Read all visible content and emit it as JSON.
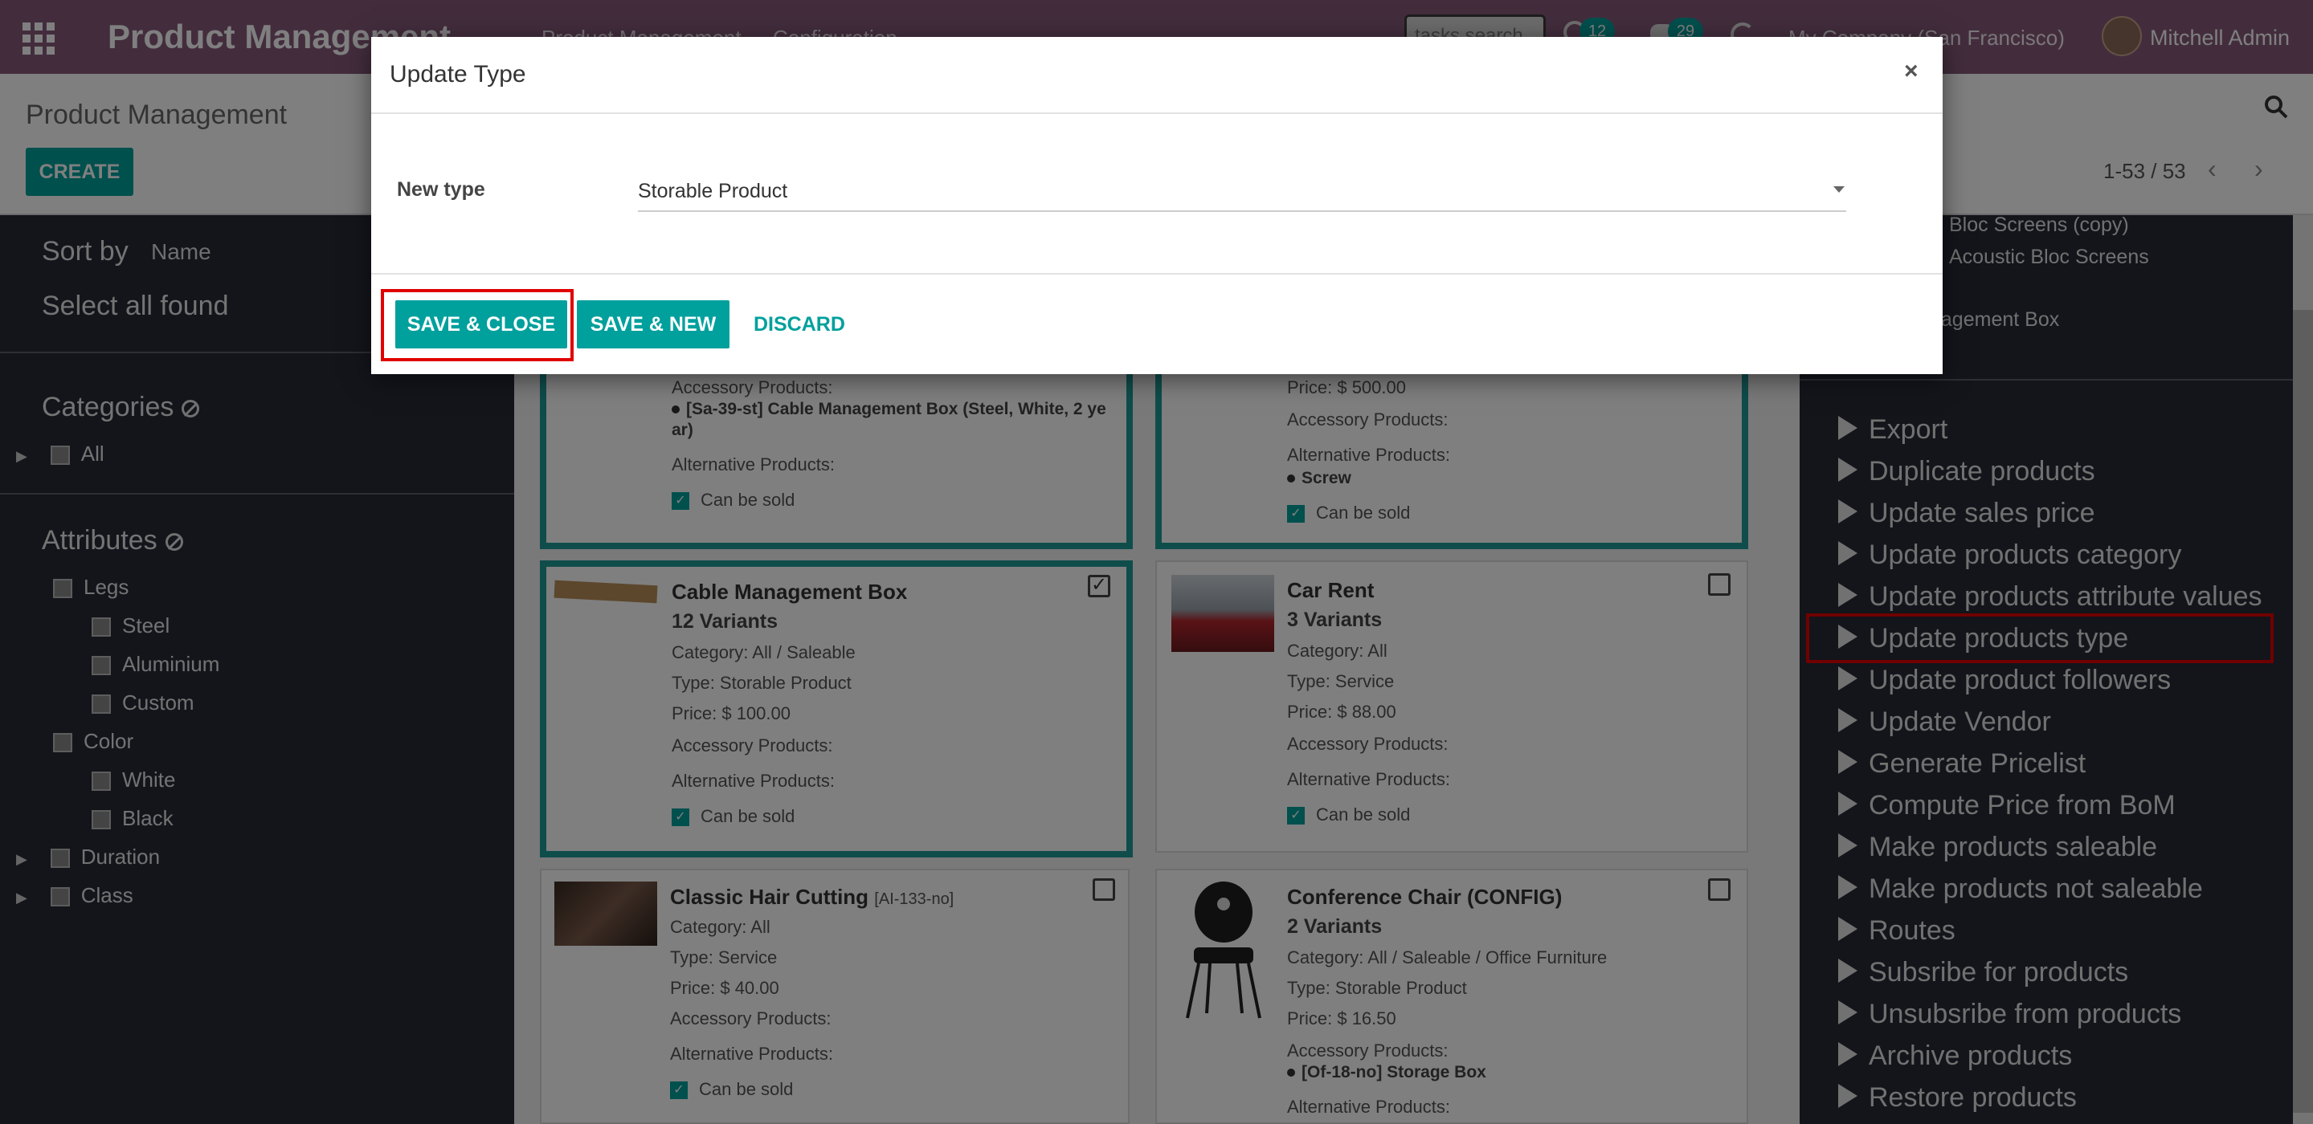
{
  "navbar": {
    "brand": "Product Management",
    "menu": [
      "Product Management",
      "Configuration"
    ],
    "search_placeholder": "tasks search",
    "activity_count": "12",
    "message_count": "29",
    "company": "My Company (San Francisco)",
    "user": "Mitchell Admin"
  },
  "control": {
    "breadcrumb": "Product Management",
    "create_label": "CREATE",
    "pager": "1-53 / 53"
  },
  "sidebar": {
    "sort_by": "Sort by",
    "sort_value": "Name",
    "select_all": "Select all found",
    "categories_title": "Categories",
    "categories": [
      "All"
    ],
    "attributes_title": "Attributes",
    "attributes": [
      {
        "label": "Legs",
        "children": [
          "Steel",
          "Aluminium",
          "Custom"
        ]
      },
      {
        "label": "Color",
        "children": [
          "White",
          "Black"
        ]
      },
      {
        "label": "Duration",
        "children": []
      },
      {
        "label": "Class",
        "children": []
      }
    ]
  },
  "cards": {
    "top_left": {
      "accessory_label": "Accessory Products:",
      "accessory_item": "[Sa-39-st] Cable Management Box (Steel, White, 2 ye",
      "accessory_item_cont": "ar)",
      "alternative_label": "Alternative Products:",
      "can_be_sold": "Can be sold"
    },
    "top_right": {
      "price": "Price: $ 500.00",
      "accessory_label": "Accessory Products:",
      "alternative_label": "Alternative Products:",
      "alternative_item": "Screw",
      "can_be_sold": "Can be sold"
    },
    "cable_box": {
      "title": "Cable Management Box",
      "variants": "12 Variants",
      "category": "Category: All / Saleable",
      "type": "Type: Storable Product",
      "price": "Price: $ 100.00",
      "accessory_label": "Accessory Products:",
      "alternative_label": "Alternative Products:",
      "can_be_sold": "Can be sold"
    },
    "car_rent": {
      "title": "Car Rent",
      "variants": "3 Variants",
      "category": "Category: All",
      "type": "Type: Service",
      "price": "Price: $ 88.00",
      "accessory_label": "Accessory Products:",
      "alternative_label": "Alternative Products:",
      "can_be_sold": "Can be sold"
    },
    "hair": {
      "title": "Classic Hair Cutting",
      "ref": "[AI-133-no]",
      "category": "Category: All",
      "type": "Type: Service",
      "price": "Price: $ 40.00",
      "accessory_label": "Accessory Products:",
      "alternative_label": "Alternative Products:",
      "can_be_sold": "Can be sold"
    },
    "chair": {
      "title": "Conference Chair (CONFIG)",
      "variants": "2 Variants",
      "category": "Category: All / Saleable / Office Furniture",
      "type": "Type: Storable Product",
      "price": "Price: $ 16.50",
      "accessory_label": "Accessory Products:",
      "accessory_item": "[Of-18-no] Storage Box",
      "alternative_label": "Alternative Products:"
    }
  },
  "right_panel": {
    "top_items": [
      "Bloc Screens (copy)",
      "Acoustic Bloc Screens",
      "nagement Box"
    ],
    "actions": [
      "Export",
      "Duplicate products",
      "Update sales price",
      "Update products category",
      "Update products attribute values",
      "Update products type",
      "Update product followers",
      "Update Vendor",
      "Generate Pricelist",
      "Compute Price from BoM",
      "Make products saleable",
      "Make products not saleable",
      "Routes",
      "Subsribe for products",
      "Unsubsribe from products",
      "Archive products",
      "Restore products"
    ],
    "highlighted": "Update products type"
  },
  "modal": {
    "title": "Update Type",
    "close": "×",
    "field_label": "New type",
    "field_value": "Storable Product",
    "save_close": "SAVE & CLOSE",
    "save_new": "SAVE & NEW",
    "discard": "DISCARD"
  },
  "colors": {
    "navbar": "#875a7b",
    "accent": "#00a09d",
    "sidebar": "#262a36",
    "highlight": "#e00000"
  }
}
